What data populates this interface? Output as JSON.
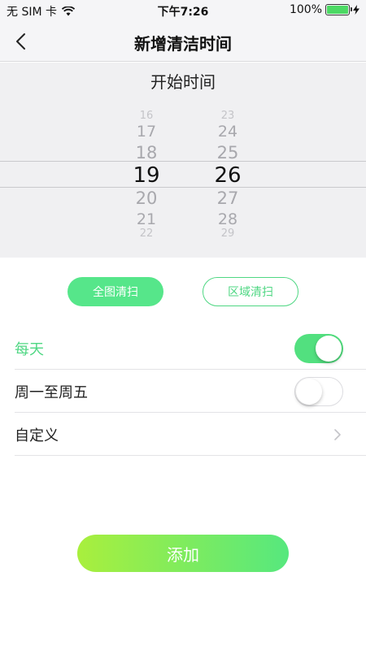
{
  "status_bar": {
    "carrier": "无 SIM 卡",
    "time": "下午7:26",
    "battery": "100%"
  },
  "nav": {
    "title": "新增清洁时间"
  },
  "picker": {
    "title": "开始时间",
    "hours": [
      "16",
      "17",
      "18",
      "19",
      "20",
      "21",
      "22"
    ],
    "minutes": [
      "23",
      "24",
      "25",
      "26",
      "27",
      "28",
      "29"
    ],
    "selected_hour": "19",
    "selected_minute": "26"
  },
  "modes": {
    "full": "全图清扫",
    "area": "区域清扫"
  },
  "repeat": {
    "everyday": {
      "label": "每天",
      "enabled": true
    },
    "weekdays": {
      "label": "周一至周五",
      "enabled": false
    },
    "custom": {
      "label": "自定义"
    }
  },
  "add_button": "添加",
  "colors": {
    "accent": "#56e68a",
    "gradient_start": "#a9ef3d",
    "gradient_end": "#56e87e"
  }
}
